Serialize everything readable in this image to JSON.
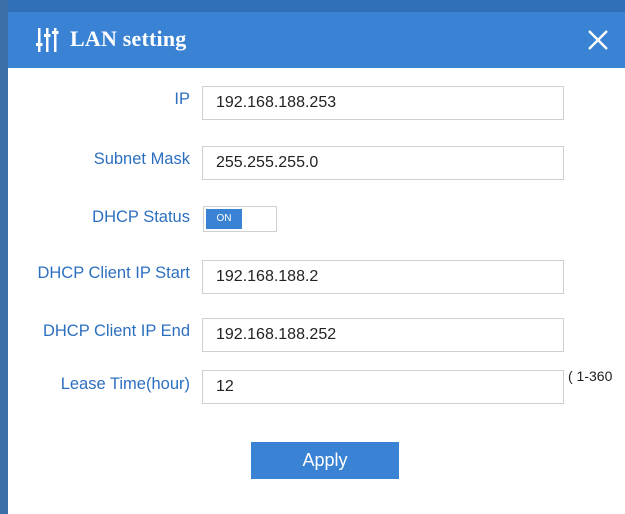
{
  "dialog": {
    "title": "LAN setting",
    "title_icon": "sliders-icon",
    "close_icon": "close-icon"
  },
  "form": {
    "ip": {
      "label": "IP",
      "value": "192.168.188.253"
    },
    "subnet": {
      "label": "Subnet Mask",
      "value": "255.255.255.0"
    },
    "dhcp_status": {
      "label": "DHCP Status",
      "toggle": "ON",
      "enabled": true
    },
    "dhcp_start": {
      "label": "DHCP Client IP Start",
      "value": "192.168.188.2"
    },
    "dhcp_end": {
      "label": "DHCP Client IP End",
      "value": "192.168.188.252"
    },
    "lease": {
      "label": "Lease Time(hour)",
      "value": "12",
      "hint": "( 1-360"
    }
  },
  "actions": {
    "apply": "Apply"
  },
  "colors": {
    "accent": "#3a82d3",
    "label": "#2d6fbf"
  }
}
